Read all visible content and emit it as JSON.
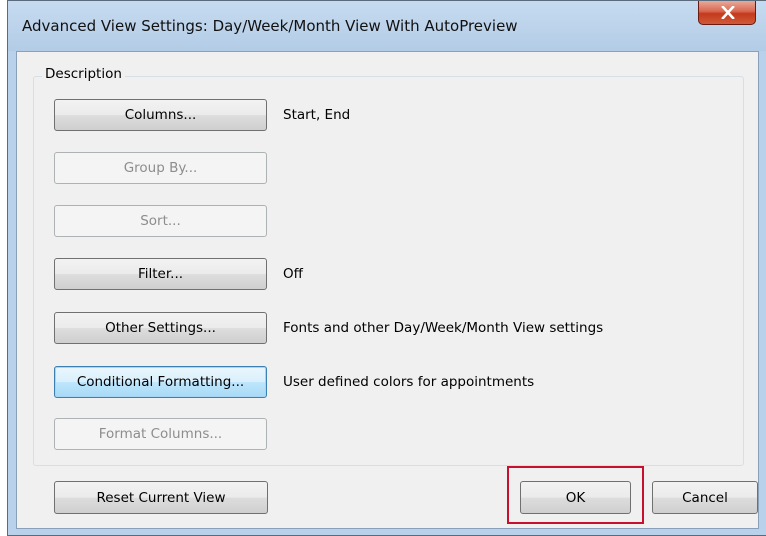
{
  "window": {
    "title": "Advanced View Settings: Day/Week/Month View With AutoPreview",
    "close_glyph": "X"
  },
  "group": {
    "label": "Description"
  },
  "rows": [
    {
      "button": "Columns...",
      "description": "Start, End",
      "enabled": true
    },
    {
      "button": "Group By...",
      "description": "",
      "enabled": false
    },
    {
      "button": "Sort...",
      "description": "",
      "enabled": false
    },
    {
      "button": "Filter...",
      "description": "Off",
      "enabled": true
    },
    {
      "button": "Other Settings...",
      "description": "Fonts and other Day/Week/Month View settings",
      "enabled": true
    },
    {
      "button": "Conditional Formatting...",
      "description": "User defined colors for appointments",
      "enabled": true
    },
    {
      "button": "Format Columns...",
      "description": "",
      "enabled": false
    }
  ],
  "footer": {
    "reset_label": "Reset Current View",
    "ok_label": "OK",
    "cancel_label": "Cancel"
  },
  "colors": {
    "highlight_box": "#c8102e",
    "title_bar": "#b9d1ea",
    "dialog_background": "#f0f0f0"
  }
}
